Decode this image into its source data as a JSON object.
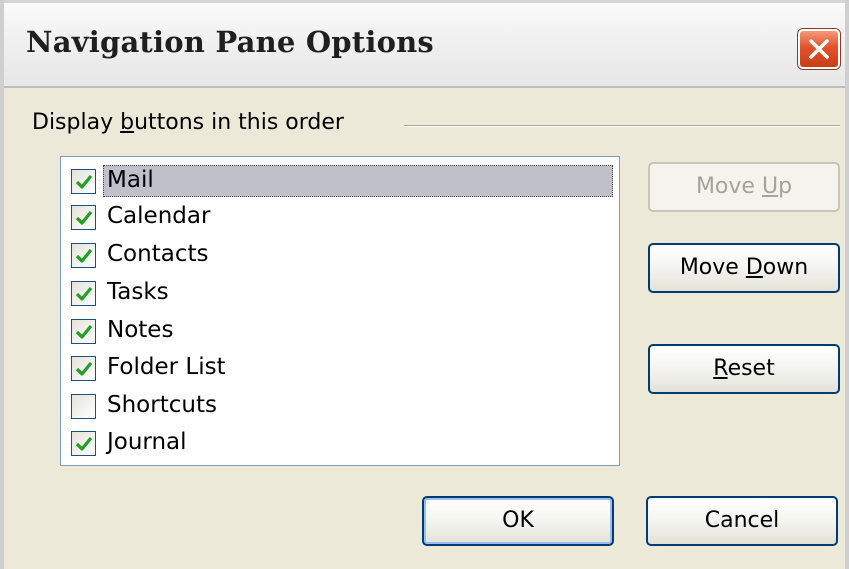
{
  "dialog": {
    "title": "Navigation Pane Options",
    "close_glyph": "✕",
    "group_label_prefix": "Display ",
    "group_label_accel": "b",
    "group_label_suffix": "uttons in this order"
  },
  "items": [
    {
      "label": "Mail",
      "checked": true,
      "selected": true
    },
    {
      "label": "Calendar",
      "checked": true,
      "selected": false
    },
    {
      "label": "Contacts",
      "checked": true,
      "selected": false
    },
    {
      "label": "Tasks",
      "checked": true,
      "selected": false
    },
    {
      "label": "Notes",
      "checked": true,
      "selected": false
    },
    {
      "label": "Folder List",
      "checked": true,
      "selected": false
    },
    {
      "label": "Shortcuts",
      "checked": false,
      "selected": false
    },
    {
      "label": "Journal",
      "checked": true,
      "selected": false
    }
  ],
  "buttons": {
    "move_up": {
      "prefix": "Move ",
      "accel": "U",
      "suffix": "p",
      "enabled": false
    },
    "move_down": {
      "prefix": "Move ",
      "accel": "D",
      "suffix": "own",
      "enabled": true
    },
    "reset": {
      "prefix": "",
      "accel": "R",
      "suffix": "eset",
      "enabled": true
    },
    "ok": {
      "label": "OK"
    },
    "cancel": {
      "label": "Cancel"
    }
  },
  "colors": {
    "face": "#ece9d8",
    "close_red": "#e2532c",
    "check_green": "#21a121",
    "selection": "#c0c0cb"
  },
  "icons": {
    "close": "close-icon",
    "check": "checkmark-icon"
  }
}
